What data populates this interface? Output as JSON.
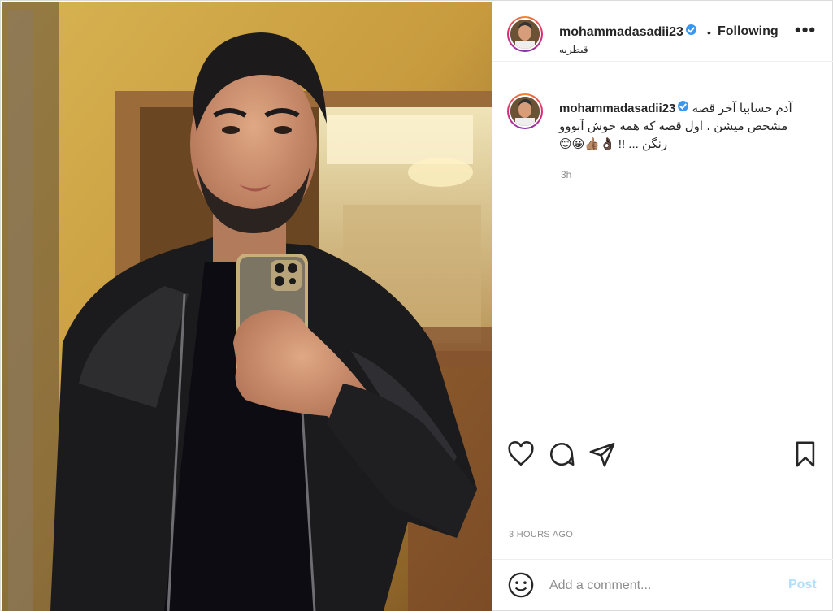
{
  "post": {
    "username": "mohammadasadii23",
    "follow_status": "Following",
    "location": "قیطریه",
    "more_label": "•••",
    "caption": "آدم حسابیا آخر قصه مشخص میشن ، اول قصه که همه خوش آبووو رنگن ... !! 👌🏿👍🏽😀😊",
    "caption_age": "3h",
    "posted_ago": "3 HOURS AGO"
  },
  "icons": {
    "like": "heart-icon",
    "comment": "comment-bubble-icon",
    "share": "paper-plane-icon",
    "save": "bookmark-icon",
    "emoji": "smiley-icon",
    "verified": "verified-badge-icon"
  },
  "comment_box": {
    "placeholder": "Add a comment...",
    "post_label": "Post"
  },
  "colors": {
    "verified": "#3897f0",
    "post_disabled": "#b2dffc",
    "muted": "#8e8e8e"
  }
}
